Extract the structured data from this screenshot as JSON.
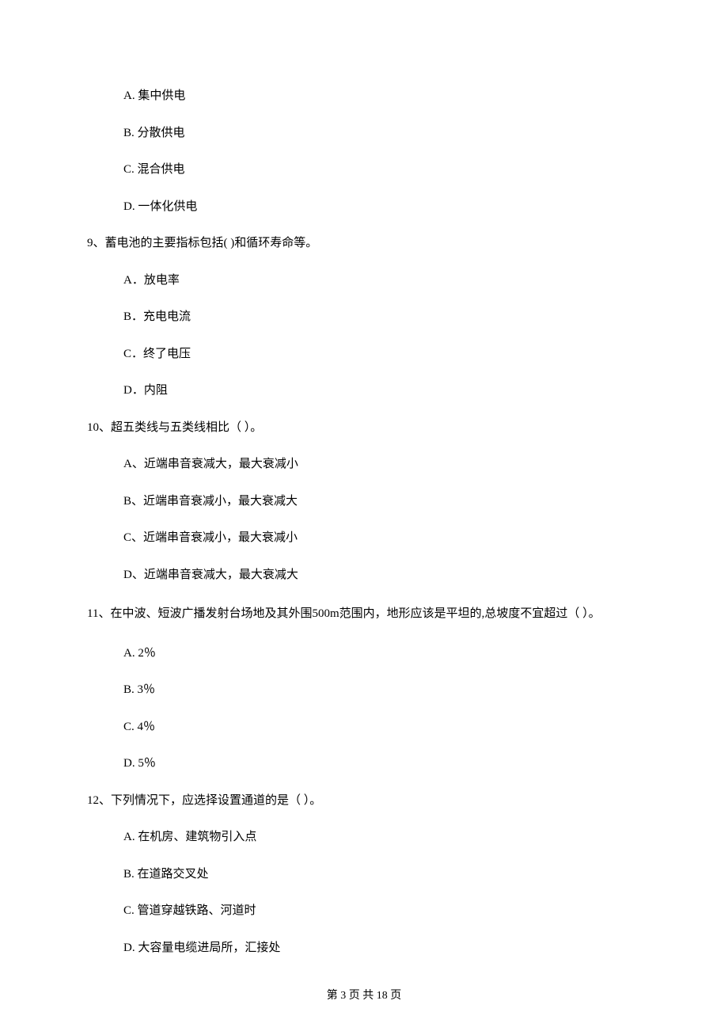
{
  "q8": {
    "options": {
      "a": "A.  集中供电",
      "b": "B.  分散供电",
      "c": "C.  混合供电",
      "d": "D.  一体化供电"
    }
  },
  "q9": {
    "text": "9、蓄电池的主要指标包括(      )和循环寿命等。",
    "options": {
      "a": "A．放电率",
      "b": "B．充电电流",
      "c": "C．终了电压",
      "d": "D．内阻"
    }
  },
  "q10": {
    "text": "10、超五类线与五类线相比（      ）。",
    "options": {
      "a": "A、近端串音衰减大，最大衰减小",
      "b": "B、近端串音衰减小，最大衰减大",
      "c": "C、近端串音衰减小，最大衰减小",
      "d": "D、近端串音衰减大，最大衰减大"
    }
  },
  "q11": {
    "text": "11、在中波、短波广播发射台场地及其外围500m范围内，地形应该是平坦的,总坡度不宜超过（      ）。",
    "options": {
      "a": "A.    2％",
      "b": "B.    3％",
      "c": "C.    4％",
      "d": "D.    5％"
    }
  },
  "q12": {
    "text": "12、下列情况下，应选择设置通道的是（      ）。",
    "options": {
      "a": "A.  在机房、建筑物引入点",
      "b": "B.  在道路交叉处",
      "c": "C.  管道穿越铁路、河道时",
      "d": "D.  大容量电缆进局所，汇接处"
    }
  },
  "footer": "第 3 页 共 18 页"
}
